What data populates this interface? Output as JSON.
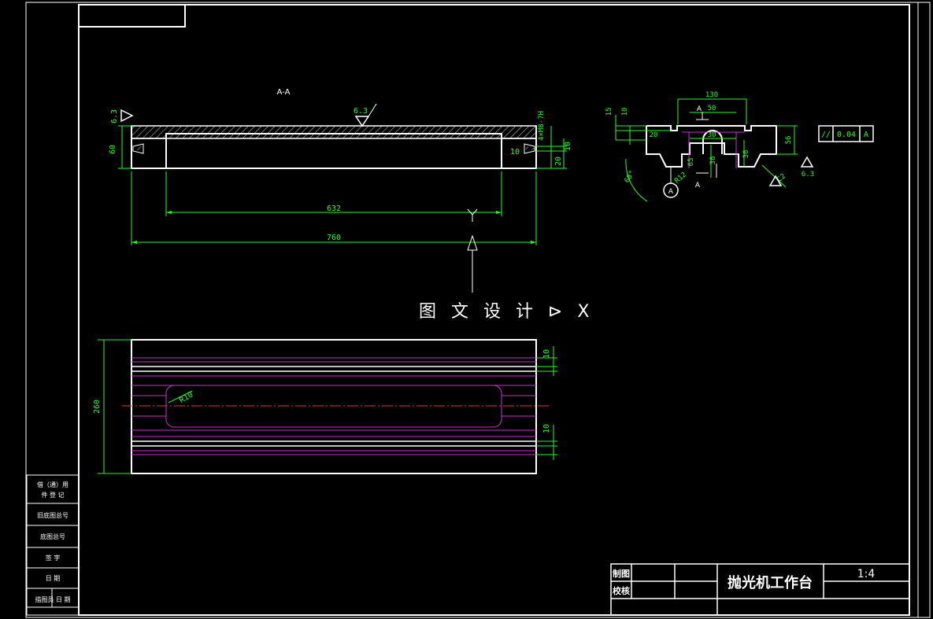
{
  "section_label": "A-A",
  "roughness": {
    "left": "6.3",
    "top": "6.3",
    "right_profile": "6.3"
  },
  "front_view": {
    "dim_height_left": "60",
    "dim_inner": "632",
    "dim_overall": "760",
    "dim_right_a": "10",
    "dim_right_b": "10",
    "dim_right_c": "20",
    "dim_right_vertical": "4×M8-7H",
    "view_letter": "Y"
  },
  "watermark": "图 文 设 计 ⊳ X",
  "plan_view": {
    "dim_width": "260",
    "dim_top_groove": "10",
    "dim_bottom_groove": "10",
    "radius_label": "R10"
  },
  "profile_view": {
    "dim_130": "130",
    "dim_50": "50",
    "dim_30": "30",
    "dim_20": "20",
    "dim_15": "15",
    "dim_10": "10",
    "dim_56": "56",
    "dim_36": "36",
    "dim_65": "65",
    "dim_36b": "36",
    "dim_angle": "60°",
    "dim_r12": "R12",
    "dim_c2": "C2",
    "section_mark_top": "A",
    "section_mark_bottom": "A",
    "datum": "A",
    "tolerance_symbol": "//",
    "tolerance_value": "0.04",
    "tolerance_datum": "A"
  },
  "left_strip": {
    "cells": [
      "借（通）用",
      "件 登 记",
      "旧底图总号",
      "底图总号",
      "签  字",
      "日  期",
      "描图员  日  期"
    ]
  },
  "title_block": {
    "drawn_label": "制图",
    "checked_label": "校核",
    "title": "抛光机工作台",
    "scale": "1:4"
  }
}
